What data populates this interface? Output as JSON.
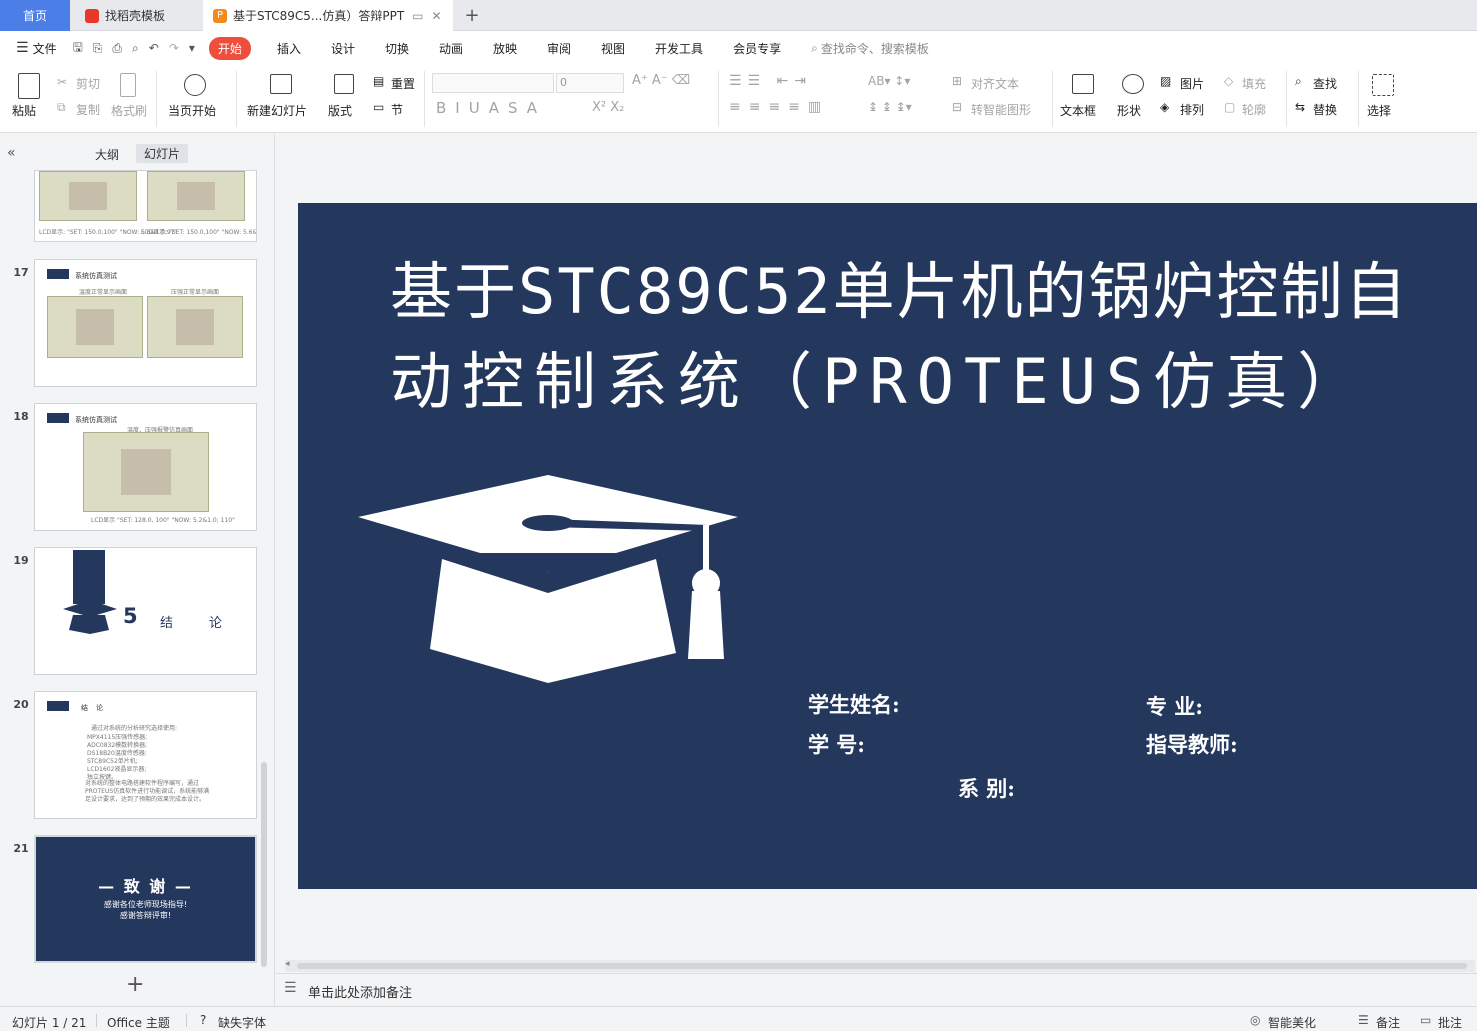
{
  "tabs": {
    "home": "首页",
    "template": "找稻壳模板",
    "doc": "基于STC89C5...仿真）答辩PPT",
    "add": "+"
  },
  "menu": {
    "file": "文件",
    "items": [
      "开始",
      "插入",
      "设计",
      "切换",
      "动画",
      "放映",
      "审阅",
      "视图",
      "开发工具",
      "会员专享"
    ],
    "search": "查找命令、搜索模板"
  },
  "ribbon": {
    "paste": "粘贴",
    "cut": "剪切",
    "copy": "复制",
    "format_painter": "格式刷",
    "from_current": "当页开始",
    "new_slide": "新建幻灯片",
    "layout": "版式",
    "reset": "重置",
    "section": "节",
    "font_size": "0",
    "align_text": "对齐文本",
    "smart_art": "转智能图形",
    "text_box": "文本框",
    "shape": "形状",
    "picture": "图片",
    "arrange": "排列",
    "fill": "填充",
    "outline": "轮廓",
    "find": "查找",
    "replace": "替换",
    "select": "选择"
  },
  "panel": {
    "outline_tab": "大纲",
    "slides_tab": "幻灯片",
    "thumbs": [
      {
        "num": "17",
        "title": "系统仿真测试",
        "caps": [
          "温度正常显示画面",
          "压强正常显示画面"
        ]
      },
      {
        "num": "18",
        "title": "系统仿真测试",
        "caps": [
          "温度、压强报警仿真画面",
          "LCD显示 \"SET: 128.0, 100\" \"NOW: 5.2&1.0; 110\""
        ]
      },
      {
        "num": "19",
        "num_big": "5",
        "label_a": "结",
        "label_b": "论"
      },
      {
        "num": "20",
        "title": "结论",
        "lines": [
          "通过对系统的分析研究选择使用:",
          "MPX4115压强传感器;",
          "ADC0832模数转换器;",
          "DS18B20温度传感器;",
          "STC89C52单片机;",
          "LCD1602液晶显示器;",
          "独立按键。",
          "对系统的整体电路搭建软件程序编写，通过PROTEUS仿真软件进行功能调试，系统能够满足设计要求，达到了预期的效果完成本设计。"
        ]
      },
      {
        "num": "21",
        "heading": "— 致 谢 —",
        "line1": "感谢各位老师现场指导!",
        "line2": "感谢答辩评审!"
      }
    ],
    "top_caps": [
      "LCD显示: \"SET: 150.0,100\" \"NOW: 5.6&1.0;97\"",
      "LCD显示: \"SET: 150.0,100\" \"NOW: 5.6&1.0;102\""
    ],
    "add_slide": "+"
  },
  "slide": {
    "title_line1": "基于STC89C52单片机的锅炉控制自",
    "title_line2": "动控制系统（PROTEUS仿真）",
    "student_name": "学生姓名:",
    "student_id": "学      号:",
    "major": "专      业:",
    "advisor": "指导教师:",
    "department": "系      别:"
  },
  "notes": {
    "placeholder": "单击此处添加备注"
  },
  "status": {
    "slide_count": "幻灯片 1 / 21",
    "theme": "Office 主题",
    "missing_font": "缺失字体",
    "beautify": "智能美化",
    "notes": "备注",
    "comment": "批注"
  },
  "colors": {
    "slide_bg": "#24375c",
    "accent": "#f04e3c",
    "home_tab": "#4c7ee8"
  }
}
